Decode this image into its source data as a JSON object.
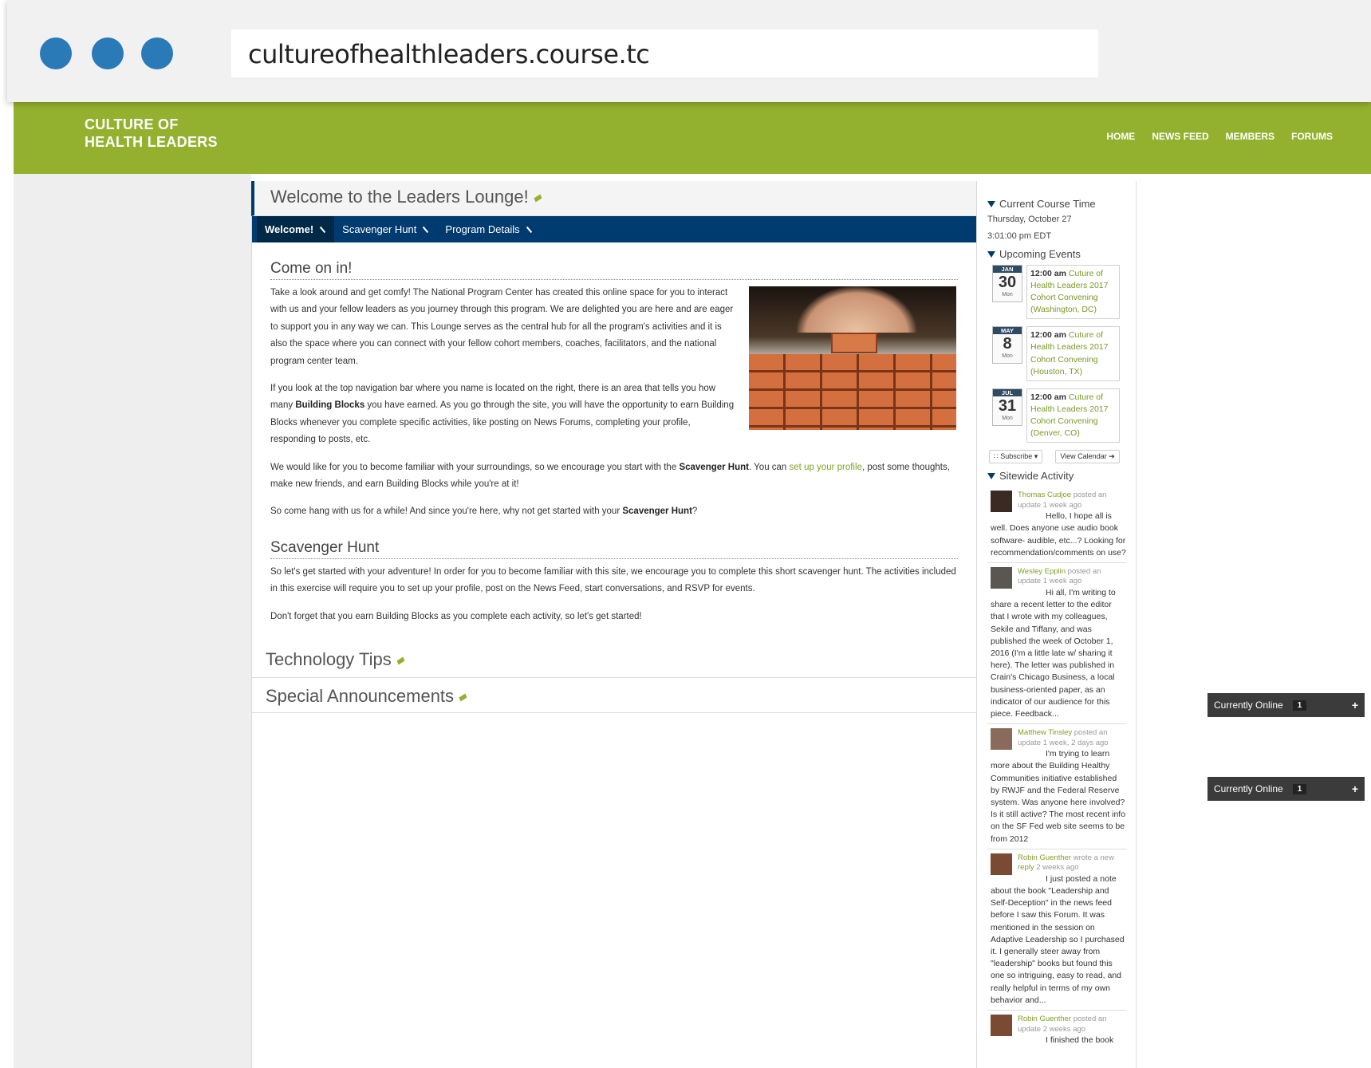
{
  "browser": {
    "url": "cultureofhealthleaders.course.tc"
  },
  "header": {
    "logo_line1": "CULTURE OF",
    "logo_line2": "HEALTH LEADERS",
    "nav": [
      "HOME",
      "NEWS FEED",
      "MEMBERS",
      "FORUMS"
    ]
  },
  "main": {
    "title": "Welcome to the Leaders Lounge!",
    "tabs": [
      "Welcome!",
      "Scavenger Hunt",
      "Program Details"
    ],
    "active_tab": "Welcome!",
    "sections": {
      "come_in": {
        "heading": "Come on in!",
        "p1": "Take a look around and get comfy! The National Program Center has created this online space for you to interact with us and your fellow leaders as you journey through this program. We are delighted you are here and are eager to support you in any way we can. This Lounge serves as the central hub for all the program's activities and it is also the space where you can connect with your fellow cohort members, coaches, facilitators, and the national program center team.",
        "p2_a": "If you look at the top navigation bar where you name is located on the right, there is an area that tells you how many ",
        "p2_b": "Building Blocks",
        "p2_c": " you have earned. As you go through the site, you will have the opportunity to earn Building Blocks whenever you complete specific activities, like posting on News Forums, completing your profile, responding to posts, etc.",
        "p3_a": "We would like for you to become familiar with your surroundings, so we encourage you start with the ",
        "p3_b": "Scavenger Hunt",
        "p3_c": ". You can ",
        "p3_link": "set up your profile",
        "p3_d": ", post some thoughts, make new friends, and earn Building Blocks while you're at it!",
        "p4_a": "So come hang with us for a while! And since you're here, why not get started with your ",
        "p4_link": "Scavenger Hunt",
        "p4_b": "?"
      },
      "scavenger": {
        "heading": "Scavenger Hunt",
        "p1": "So let's get started with your adventure! In order for you to become familiar with this site, we encourage you to complete this short scavenger hunt. The activities included in this exercise will require you to set up your profile, post on the News Feed, start conversations, and RSVP for events.",
        "p2": "Don't forget that you earn Building Blocks as you complete each activity, so let's get started!"
      }
    },
    "folds": [
      "Technology Tips",
      "Special Announcements"
    ]
  },
  "side": {
    "course_time_heading": "Current Course Time",
    "course_date": "Thursday, October 27",
    "course_time": "3:01:00 pm EDT",
    "events_heading": "Upcoming Events",
    "events": [
      {
        "month": "JAN",
        "day": "30",
        "weekday": "Mon",
        "time": "12:00 am",
        "title": "Cuture of Health Leaders 2017 Cohort Convening (Washington, DC)"
      },
      {
        "month": "MAY",
        "day": "8",
        "weekday": "Mon",
        "time": "12:00 am",
        "title": "Cuture of Health Leaders 2017 Cohort Convening (Houston, TX)"
      },
      {
        "month": "JUL",
        "day": "31",
        "weekday": "Mon",
        "time": "12:00 am",
        "title": "Cuture of Health Leaders 2017 Cohort Convening (Denver, CO)"
      }
    ],
    "subscribe_label": "Subscribe",
    "calendar_label": "View Calendar",
    "activity_heading": "Sitewide Activity",
    "activity": [
      {
        "name": "Thomas Cudjoe",
        "action": "posted an update",
        "when": "1 week ago",
        "text": "Hello, I hope all is well. Does anyone use audio book software- audible, etc...? Looking for recommendation/comments on use?"
      },
      {
        "name": "Wesley Epplin",
        "action": "posted an update",
        "when": "1 week ago",
        "text": "Hi all, I'm writing to share a recent letter to the editor that I wrote with my colleagues, Sekile and Tiffany, and was published the week of October 1, 2016 (I'm a little late w/ sharing it here). The letter was published in Crain's Chicago Business, a local business-oriented paper, as an indicator of our audience for this piece. Feedback..."
      },
      {
        "name": "Matthew Tinsley",
        "action": "posted an update",
        "when": "1 week, 2 days ago",
        "text": "I'm trying to learn more about the Building Healthy Communities initiative established by RWJF and the Federal Reserve system. Was anyone here involved? Is it still active? The most recent info on the SF Fed web site seems to be from 2012"
      },
      {
        "name": "Robin Guenther",
        "action": "wrote a new",
        "action_link": "reply",
        "when": "2 weeks ago",
        "text": "I just posted a note about the book \"Leadership and Self-Deception\" in the news feed before I saw this Forum. It was mentioned in the session on Adaptive Leadership so I purchased it. I generally steer away from \"leadership\" books but found this one so intriguing, easy to read, and really helpful in terms of my own behavior and..."
      },
      {
        "name": "Robin Guenther",
        "action": "posted an update",
        "when": "2 weeks ago",
        "text": "I finished the book"
      }
    ]
  },
  "online_widgets": [
    {
      "label": "Currently Online",
      "count": "1"
    },
    {
      "label": "Currently Online",
      "count": "1"
    }
  ],
  "colors": {
    "brand_green": "#93b12e",
    "navy": "#003b6f",
    "link_green": "#7fa128"
  }
}
